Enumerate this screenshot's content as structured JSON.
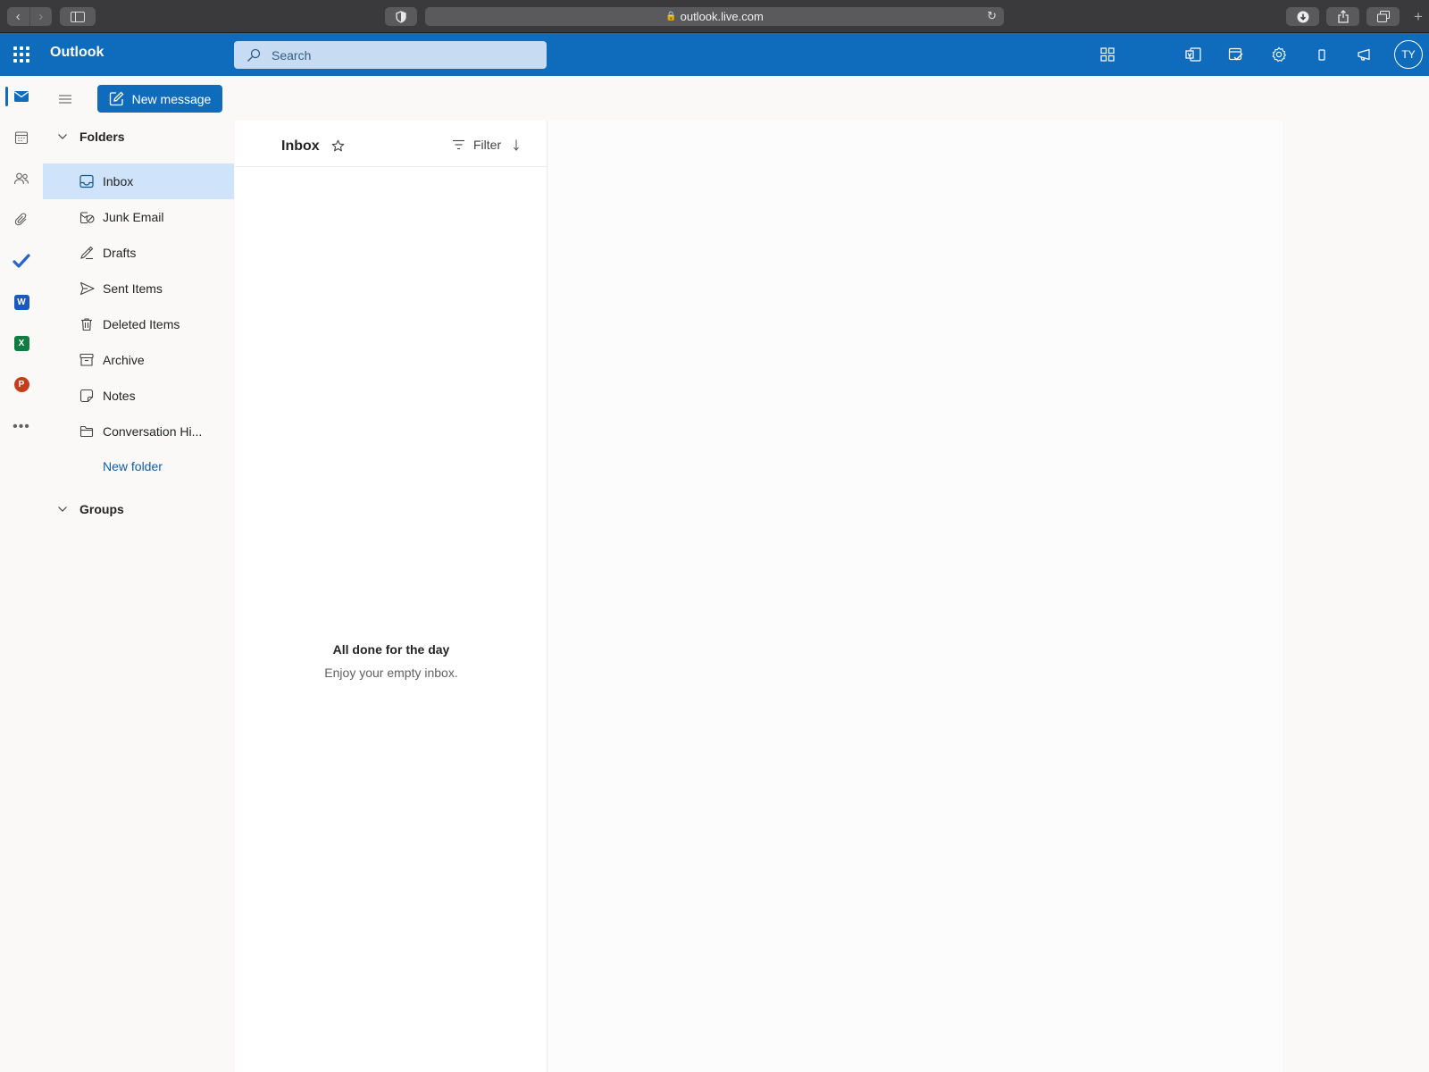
{
  "browser": {
    "url": "outlook.live.com"
  },
  "header": {
    "app_name": "Outlook",
    "search_placeholder": "Search",
    "avatar_initials": "TY"
  },
  "app_rail": {
    "items": [
      "mail",
      "calendar",
      "people",
      "attachments",
      "to-do",
      "word",
      "excel",
      "powerpoint",
      "more-apps"
    ],
    "word_letter": "W",
    "excel_letter": "X",
    "powerpoint_letter": "P"
  },
  "toolbar": {
    "new_message_label": "New message"
  },
  "folders": {
    "section_label": "Folders",
    "items": [
      {
        "label": "Inbox",
        "icon": "inbox-icon",
        "active": true
      },
      {
        "label": "Junk Email",
        "icon": "junk-icon"
      },
      {
        "label": "Drafts",
        "icon": "drafts-icon"
      },
      {
        "label": "Sent Items",
        "icon": "send-icon"
      },
      {
        "label": "Deleted Items",
        "icon": "trash-icon"
      },
      {
        "label": "Archive",
        "icon": "archive-icon"
      },
      {
        "label": "Notes",
        "icon": "note-icon"
      },
      {
        "label": "Conversation Hi...",
        "icon": "folder-icon"
      }
    ],
    "new_folder_label": "New folder",
    "groups_label": "Groups"
  },
  "message_list": {
    "title": "Inbox",
    "filter_label": "Filter",
    "empty_title": "All done for the day",
    "empty_subtitle": "Enjoy your empty inbox."
  },
  "colors": {
    "brand_blue": "#0f6cbd",
    "active_folder": "#cfe4fa",
    "link": "#115ea3"
  }
}
